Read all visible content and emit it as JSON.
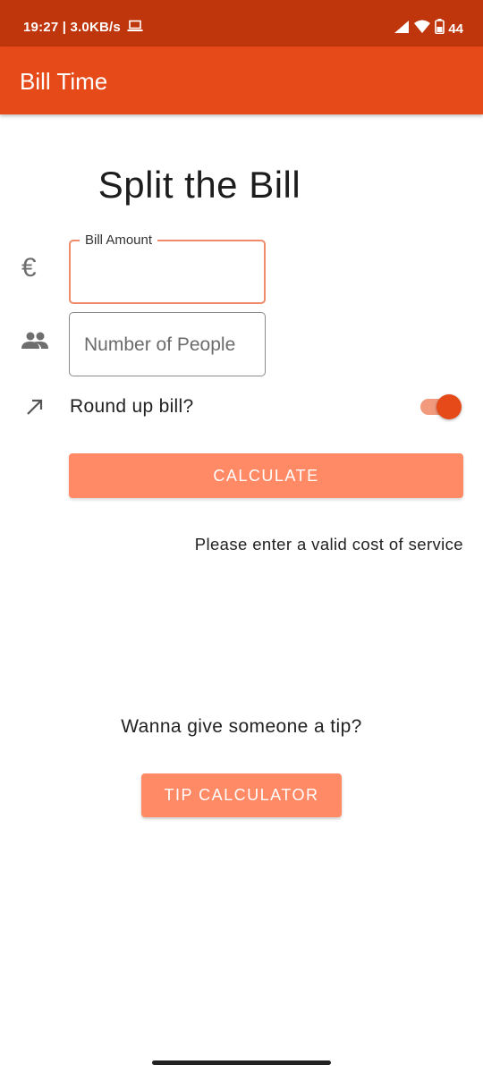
{
  "status_bar": {
    "time": "19:27",
    "network_speed": "3.0KB/s",
    "battery": "44",
    "icons": [
      "laptop-icon",
      "signal-icon",
      "wifi-icon",
      "battery-icon"
    ]
  },
  "app_bar": {
    "title": "Bill Time",
    "color": "#e64a19"
  },
  "main": {
    "heading": "Split the Bill",
    "bill_amount": {
      "label": "Bill Amount",
      "value": "",
      "icon": "euro-icon",
      "prefix_symbol": "€"
    },
    "number_of_people": {
      "placeholder": "Number of People",
      "value": "",
      "icon": "people-icon"
    },
    "round_up": {
      "label": "Round up bill?",
      "icon": "arrow-up-right-icon",
      "enabled": true
    },
    "calculate_button": "CALCULATE",
    "result_message": "Please enter a valid cost of service"
  },
  "tip_section": {
    "question": "Wanna give someone a tip?",
    "button": "TIP CALCULATOR"
  },
  "colors": {
    "status_bar": "#c0360c",
    "accent": "#e64a19",
    "button": "#ff8a65",
    "focused_outline": "#ef8a6a"
  }
}
